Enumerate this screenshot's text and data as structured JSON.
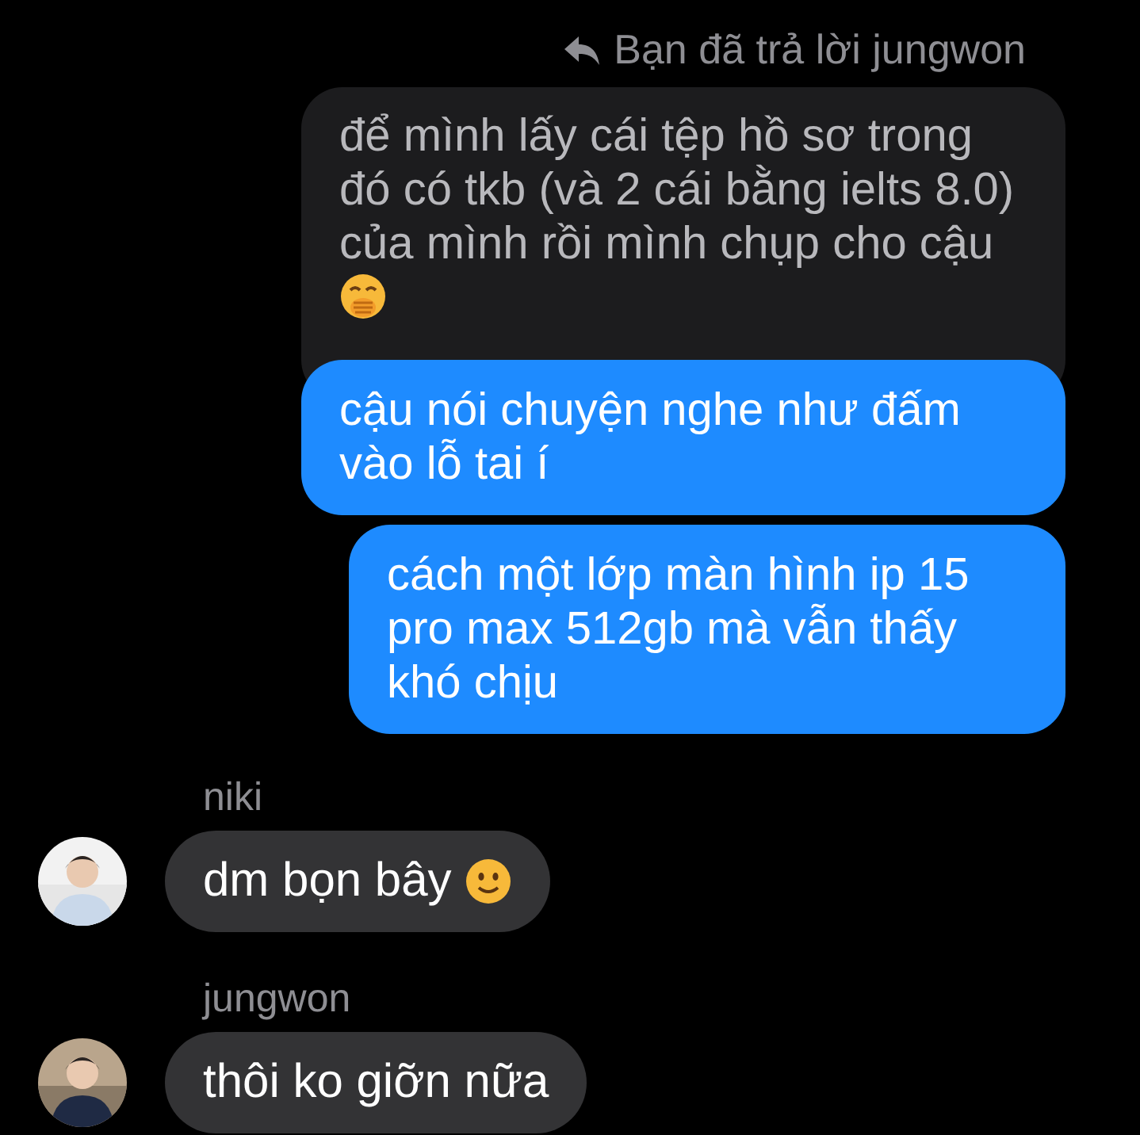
{
  "reply_header": {
    "text": "Bạn đã trả lời jungwon"
  },
  "quoted_message": {
    "text": "để mình lấy cái tệp hồ sơ trong đó có tkb (và 2 cái bằng ielts 8.0) của mình rồi mình chụp cho cậu",
    "icon": {
      "kind": "hand_over_mouth"
    }
  },
  "outgoing_messages": [
    {
      "text": "cậu nói chuyện nghe như đấm vào lỗ tai í"
    },
    {
      "text": "cách một lớp màn hình ip 15 pro max 512gb mà vẫn thấy khó chịu"
    }
  ],
  "incoming_messages": [
    {
      "sender": "niki",
      "text": "dm bọn bây",
      "icon": {
        "kind": "slight_smile"
      }
    },
    {
      "sender": "jungwon",
      "text": "thôi ko giỡn nữa"
    }
  ]
}
